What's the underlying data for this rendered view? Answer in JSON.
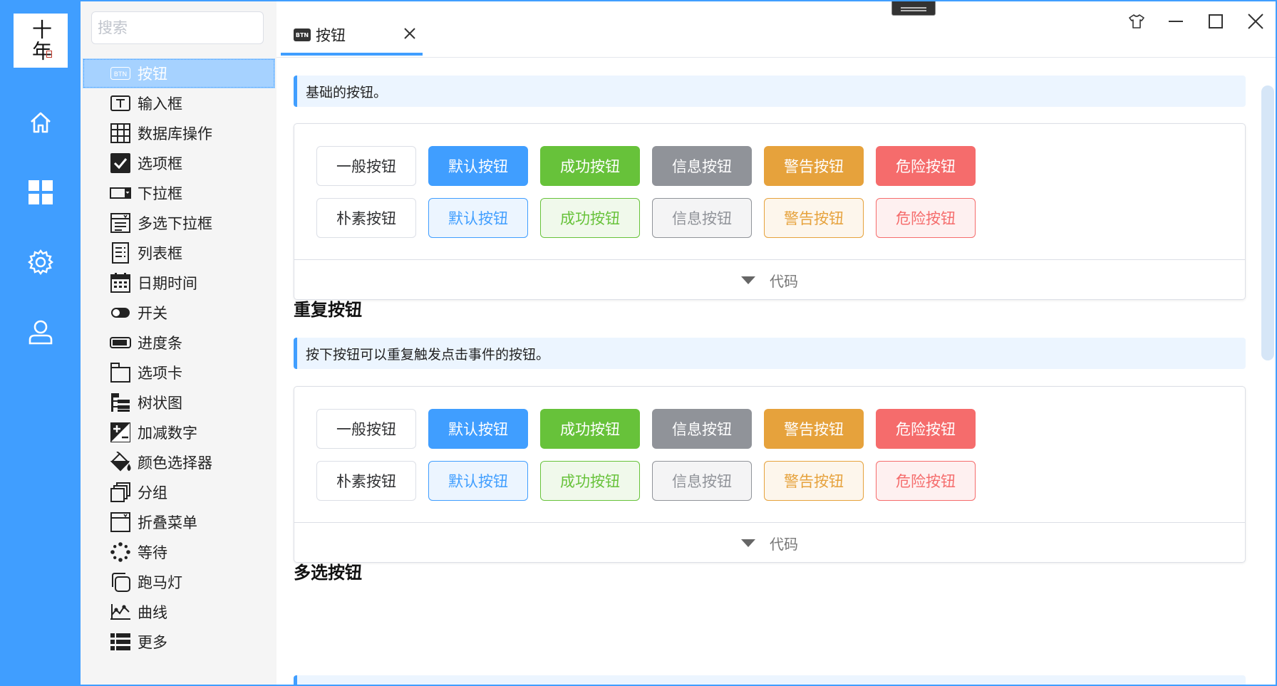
{
  "logo": {
    "text": "十年"
  },
  "rail": {
    "icons": [
      "home-icon",
      "dashboard-icon",
      "settings-icon",
      "user-icon"
    ]
  },
  "search": {
    "placeholder": "搜索",
    "value": ""
  },
  "sidebar": {
    "items": [
      {
        "label": "按钮",
        "icon": "btn-icon",
        "active": true
      },
      {
        "label": "输入框",
        "icon": "textbox-icon"
      },
      {
        "label": "数据库操作",
        "icon": "table-icon"
      },
      {
        "label": "选项框",
        "icon": "checkbox-icon"
      },
      {
        "label": "下拉框",
        "icon": "dropdown-icon"
      },
      {
        "label": "多选下拉框",
        "icon": "multi-dropdown-icon"
      },
      {
        "label": "列表框",
        "icon": "listbox-icon"
      },
      {
        "label": "日期时间",
        "icon": "calendar-icon"
      },
      {
        "label": "开关",
        "icon": "toggle-icon"
      },
      {
        "label": "进度条",
        "icon": "progress-icon"
      },
      {
        "label": "选项卡",
        "icon": "tab-icon"
      },
      {
        "label": "树状图",
        "icon": "tree-icon"
      },
      {
        "label": "加减数字",
        "icon": "plus-minus-icon"
      },
      {
        "label": "颜色选择器",
        "icon": "paint-bucket-icon"
      },
      {
        "label": "分组",
        "icon": "group-icon"
      },
      {
        "label": "折叠菜单",
        "icon": "collapse-icon"
      },
      {
        "label": "等待",
        "icon": "spinner-icon"
      },
      {
        "label": "跑马灯",
        "icon": "marquee-icon"
      },
      {
        "label": "曲线",
        "icon": "chart-icon"
      },
      {
        "label": "更多",
        "icon": "more-list-icon"
      }
    ]
  },
  "tab": {
    "icon_text": "BTN",
    "label": "按钮"
  },
  "window": {
    "controls": [
      "skin-icon",
      "minimize-icon",
      "maximize-icon",
      "close-icon"
    ]
  },
  "content": {
    "sections": [
      {
        "title": "",
        "tip": "基础的按钮。",
        "row1": [
          "一般按钮",
          "默认按钮",
          "成功按钮",
          "信息按钮",
          "警告按钮",
          "危险按钮"
        ],
        "row2": [
          "朴素按钮",
          "默认按钮",
          "成功按钮",
          "信息按钮",
          "警告按钮",
          "危险按钮"
        ],
        "code_label": "代码"
      },
      {
        "title": "重复按钮",
        "tip": "按下按钮可以重复触发点击事件的按钮。",
        "row1": [
          "一般按钮",
          "默认按钮",
          "成功按钮",
          "信息按钮",
          "警告按钮",
          "危险按钮"
        ],
        "row2": [
          "朴素按钮",
          "默认按钮",
          "成功按钮",
          "信息按钮",
          "警告按钮",
          "危险按钮"
        ],
        "code_label": "代码"
      },
      {
        "title": "多选按钮"
      }
    ]
  },
  "colors": {
    "primary": "#409eff",
    "success": "#67c23a",
    "info": "#909399",
    "warning": "#e6a23c",
    "danger": "#f56c6c"
  }
}
